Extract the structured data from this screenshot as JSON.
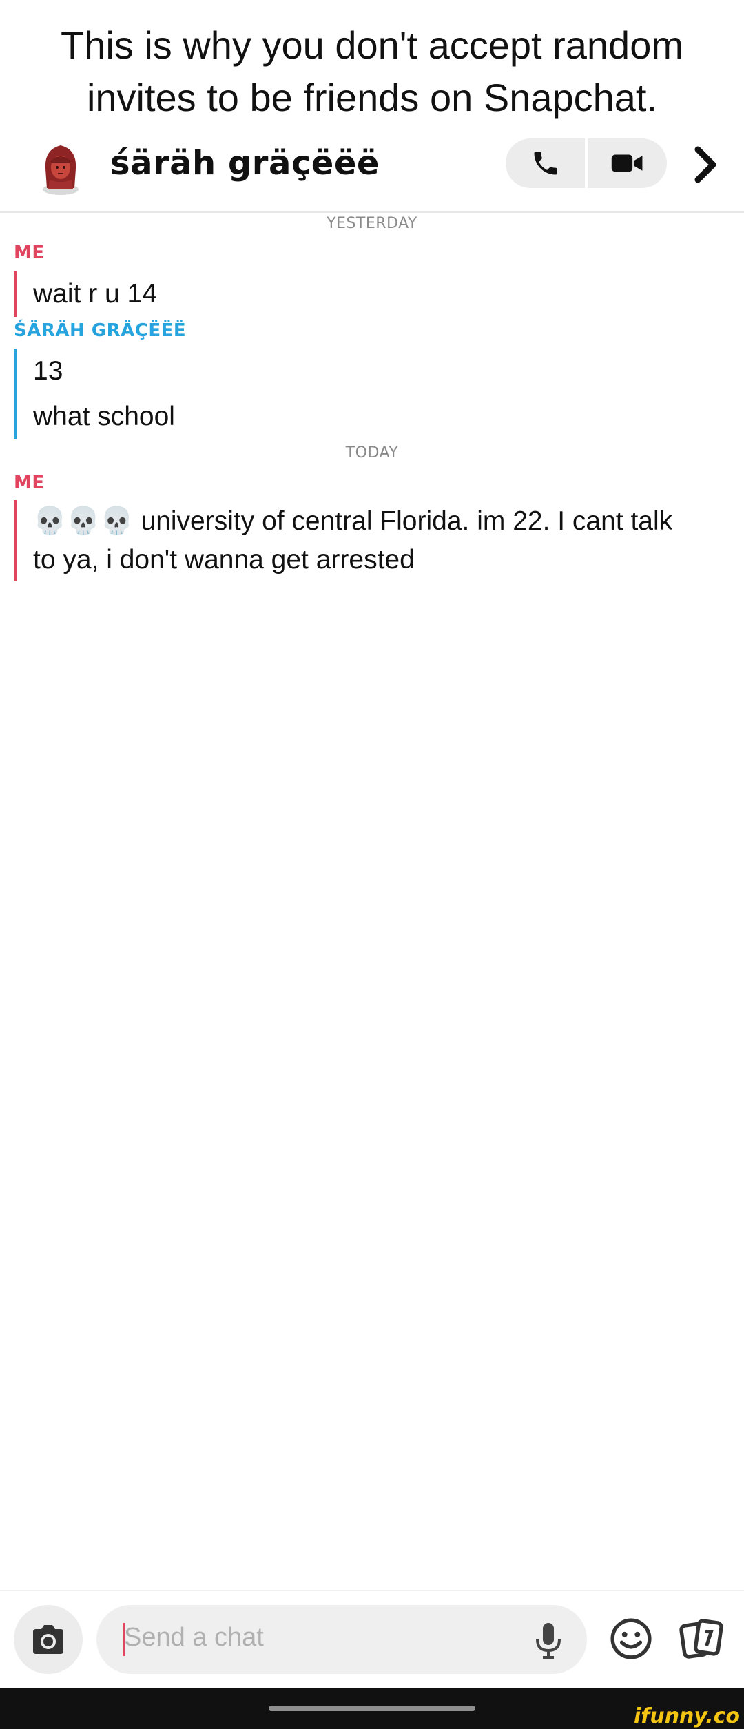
{
  "caption": {
    "line1": "This is why you don't accept random",
    "line2": "invites to be friends on Snapchat."
  },
  "header": {
    "chat_name": "śäräh gräçëëë",
    "icons": [
      "bitmoji-avatar",
      "phone-icon",
      "video-icon",
      "chevron-right-icon"
    ]
  },
  "conversation": {
    "day1": "YESTERDAY",
    "group1_sender": "ME",
    "group1_messages": [
      "wait r u 14"
    ],
    "group2_sender": "ŚÄRÄH GRÄÇËËË",
    "group2_messages": [
      "13",
      "what school"
    ],
    "day2": "TODAY",
    "group3_sender": "ME",
    "group3_line1": "💀💀💀 university of central Florida. im 22. I cant talk",
    "group3_line2": "to ya, i don't wanna get arrested"
  },
  "input": {
    "placeholder": "Send a chat",
    "icons": [
      "camera-icon",
      "mic-icon",
      "smile-icon",
      "cards-icon"
    ]
  },
  "watermark": "ifunny.co",
  "colors": {
    "me": "#e0445f",
    "them": "#27a3de",
    "accent_cursor": "#e0445f"
  }
}
